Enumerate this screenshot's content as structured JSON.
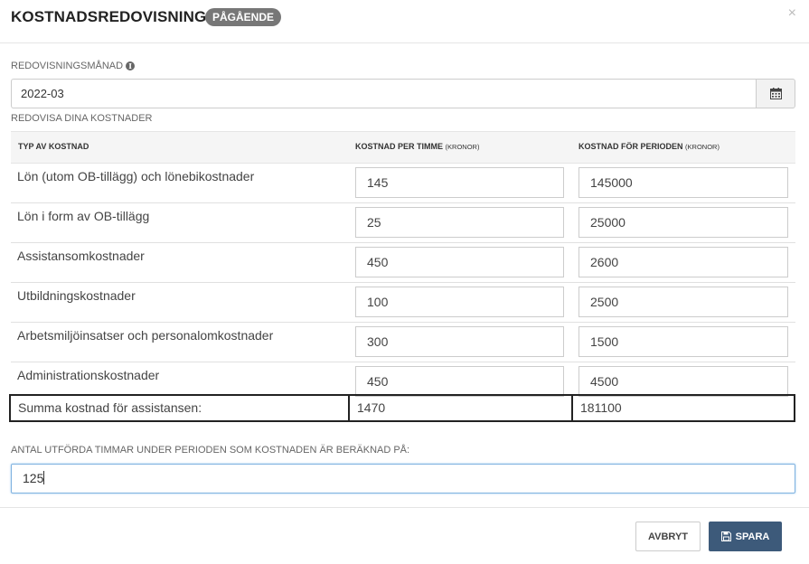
{
  "header": {
    "title": "KOSTNADSREDOVISNING",
    "status_badge": "PÅGÅENDE",
    "close": "×"
  },
  "month": {
    "label": "REDOVISNINGSMÅNAD",
    "value": "2022-03"
  },
  "costs_label": "REDOVISA DINA KOSTNADER",
  "table": {
    "col_type": "TYP AV KOSTNAD",
    "col_per_hour": "KOSTNAD PER TIMME",
    "col_per_hour_unit": "(KRONOR)",
    "col_period": "KOSTNAD FÖR PERIODEN",
    "col_period_unit": "(KRONOR)",
    "rows": [
      {
        "name": "Lön (utom OB-tillägg) och lönebikostnader",
        "per_hour": "145",
        "period": "145000"
      },
      {
        "name": "Lön i form av OB-tillägg",
        "per_hour": "25",
        "period": "25000"
      },
      {
        "name": "Assistansomkostnader",
        "per_hour": "450",
        "period": "2600"
      },
      {
        "name": "Utbildningskostnader",
        "per_hour": "100",
        "period": "2500"
      },
      {
        "name": "Arbetsmiljöinsatser och personalomkostnader",
        "per_hour": "300",
        "period": "1500"
      },
      {
        "name": "Administrationskostnader",
        "per_hour": "450",
        "period": "4500"
      }
    ],
    "sum": {
      "label": "Summa kostnad för assistansen:",
      "per_hour": "1470",
      "period": "181100"
    }
  },
  "hours": {
    "label": "ANTAL UTFÖRDA TIMMAR UNDER PERIODEN SOM KOSTNADEN ÄR BERÄKNAD PÅ:",
    "value": "125"
  },
  "footer": {
    "cancel": "AVBRYT",
    "save": "SPARA"
  }
}
